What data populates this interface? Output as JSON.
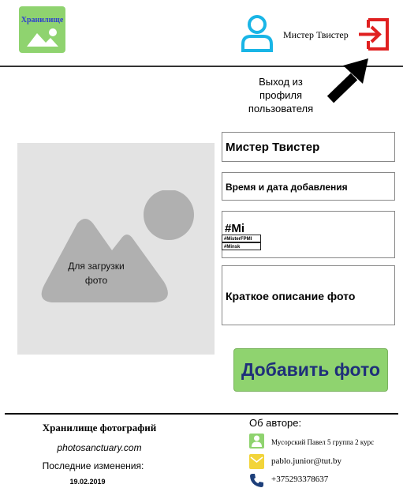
{
  "header": {
    "logo_text": "Хранилище",
    "user_name": "Мистер Твистер",
    "logout_caption": "Выход из профиля пользователя"
  },
  "upload": {
    "placeholder": "Для загрузки фото"
  },
  "form": {
    "name_value": "Мистер Твистер",
    "datetime_label": "Время и дата добавления",
    "tags_value": "#Mi",
    "tag_suggestions": [
      "#MisterFPMI",
      "#Minsk"
    ],
    "description_label": "Краткое описание фото",
    "submit_label": "Добавить фото"
  },
  "footer": {
    "title": "Хранилище фотографий",
    "site": "photosanctuary.com",
    "last_changes_label": "Последние изменения:",
    "last_changes_date": "19.02.2019",
    "author_heading": "Об авторе:",
    "author_name": "Мусорский Павел 5 группа 2 курс",
    "author_email": "pablo.junior@tut.by",
    "author_phone": "+375293378637"
  },
  "colors": {
    "accent_green": "#8fd36f",
    "logout_red": "#e02020",
    "user_cyan": "#19b5e6",
    "mail_yellow": "#f2d43a",
    "button_text": "#1f2f7a"
  },
  "icons": [
    "image-icon",
    "user-icon",
    "logout-icon",
    "arrow-icon",
    "person-icon",
    "mail-icon",
    "phone-icon"
  ]
}
